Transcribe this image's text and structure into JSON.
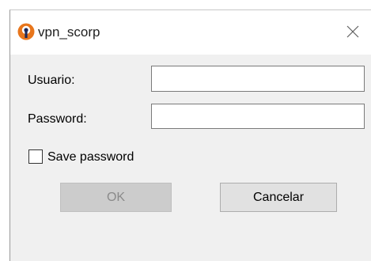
{
  "window": {
    "title": "vpn_scorp",
    "icon": "openvpn-logo-icon",
    "close_icon": "close-icon"
  },
  "form": {
    "username_label": "Usuario:",
    "username_value": "",
    "password_label": "Password:",
    "password_value": "",
    "save_password_label": "Save password",
    "save_password_checked": false
  },
  "buttons": {
    "ok_label": "OK",
    "ok_enabled": false,
    "cancel_label": "Cancelar"
  },
  "colors": {
    "brand_orange": "#e8761c",
    "brand_navy": "#1e2a5a"
  }
}
